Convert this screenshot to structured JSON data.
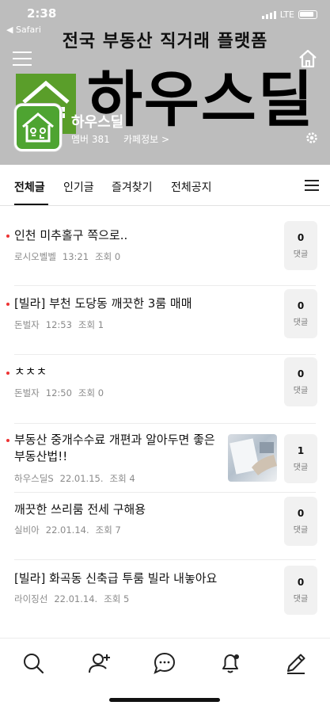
{
  "status": {
    "time": "2:38",
    "back_app": "◀ Safari",
    "network": "LTE"
  },
  "banner": {
    "text": "전국 부동산 직거래 플랫폼",
    "logo_text": "하우스딜"
  },
  "cafe": {
    "name": "하우스딜",
    "member_label": "멤버 381",
    "info_label": "카페정보 >"
  },
  "tabs": [
    {
      "label": "전체글",
      "active": true
    },
    {
      "label": "인기글"
    },
    {
      "label": "즐겨찾기"
    },
    {
      "label": "전체공지"
    }
  ],
  "posts": [
    {
      "title": "인천 미추홀구 쪽으로..",
      "author": "로시오벨벨",
      "time": "13:21",
      "views": "조회 0",
      "comments": "0",
      "comment_label": "댓글",
      "new": true
    },
    {
      "title": "[빌라] 부천 도당동 깨끗한 3룸 매매",
      "author": "돈벌자",
      "time": "12:53",
      "views": "조회 1",
      "comments": "0",
      "comment_label": "댓글",
      "new": true
    },
    {
      "title": "ㅊㅊㅊ",
      "author": "돈벌자",
      "time": "12:50",
      "views": "조회 0",
      "comments": "0",
      "comment_label": "댓글",
      "new": true
    },
    {
      "title": "부동산 중개수수료 개편과 알아두면 좋은 부동산법!!",
      "author": "하우스딜S",
      "time": "22.01.15.",
      "views": "조회 4",
      "comments": "1",
      "comment_label": "댓글",
      "new": true,
      "has_thumb": true
    },
    {
      "title": "깨끗한 쓰리룸 전세 구해용",
      "author": "실비아",
      "time": "22.01.14.",
      "views": "조회 7",
      "comments": "0",
      "comment_label": "댓글",
      "new": false
    },
    {
      "title": "[빌라] 화곡동 신축급 투룸 빌라 내놓아요",
      "author": "라이징선",
      "time": "22.01.14.",
      "views": "조회 5",
      "comments": "0",
      "comment_label": "댓글",
      "new": false
    }
  ],
  "nav_icons": [
    "search-icon",
    "add-member-icon",
    "chat-icon",
    "notification-icon",
    "write-icon"
  ],
  "colors": {
    "header_bg": "#bdbdbd",
    "brand_green": "#4ea431",
    "new_dot": "#e33333"
  }
}
